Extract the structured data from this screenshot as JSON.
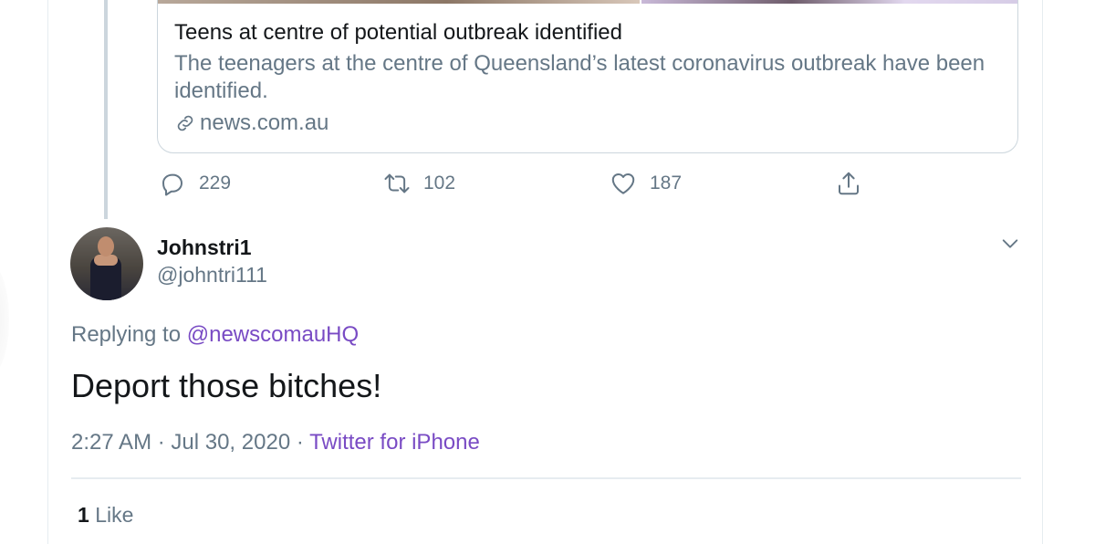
{
  "link_card": {
    "title": "Teens at centre of potential outbreak identified",
    "description": "The teenagers at the centre of Queensland’s latest coronavirus outbreak have been identified.",
    "domain": "news.com.au",
    "domain_icon": "link-icon"
  },
  "actions": {
    "reply": {
      "icon": "reply-icon",
      "count": "229"
    },
    "retweet": {
      "icon": "retweet-icon",
      "count": "102"
    },
    "like": {
      "icon": "heart-icon",
      "count": "187"
    },
    "share": {
      "icon": "share-icon"
    }
  },
  "reply_tweet": {
    "display_name": "Johnstri1",
    "handle": "@johntri111",
    "replying_prefix": "Replying to ",
    "replying_to": "@newscomauHQ",
    "text": "Deport those bitches!",
    "time": "2:27 AM",
    "date": "Jul 30, 2020",
    "separator": " · ",
    "source": "Twitter for iPhone",
    "likes_count": "1",
    "likes_label": "Like"
  },
  "colors": {
    "text_primary": "#14171a",
    "text_secondary": "#657786",
    "link": "#794bc4",
    "border": "#e6ecf0"
  }
}
